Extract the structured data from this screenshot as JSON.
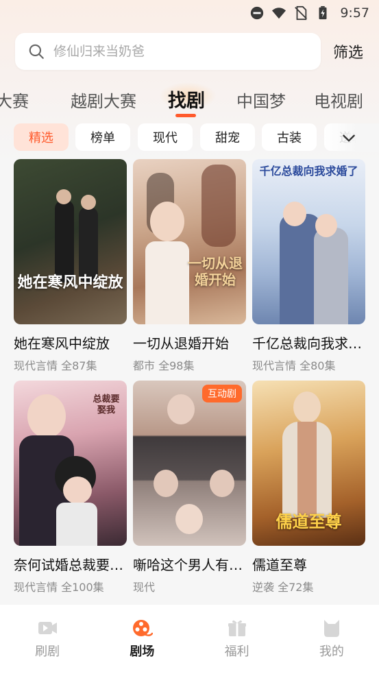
{
  "status_bar": {
    "time": "9:57",
    "icons": [
      "dnd-icon",
      "wifi-icon",
      "no-sim-icon",
      "battery-charging-icon"
    ]
  },
  "search": {
    "placeholder": "修仙归来当奶爸",
    "filter_label": "筛选"
  },
  "category_tabs": [
    {
      "label": "大赛",
      "active": false
    },
    {
      "label": "越剧大赛",
      "active": false
    },
    {
      "label": "找剧",
      "active": true
    },
    {
      "label": "中国梦",
      "active": false
    },
    {
      "label": "电视剧",
      "active": false
    }
  ],
  "genre_chips": [
    {
      "label": "精选",
      "active": true
    },
    {
      "label": "榜单",
      "active": false
    },
    {
      "label": "现代",
      "active": false
    },
    {
      "label": "甜宠",
      "active": false
    },
    {
      "label": "古装",
      "active": false
    },
    {
      "label": "逆袭",
      "active": false
    }
  ],
  "dramas": [
    {
      "title": "她在寒风中绽放",
      "meta": "现代言情 全87集",
      "cover_text": "她在寒风中绽放",
      "badge": ""
    },
    {
      "title": "一切从退婚开始",
      "meta": "都市 全98集",
      "cover_text": "一切从退婚开始",
      "badge": ""
    },
    {
      "title": "千亿总裁向我求婚了",
      "meta": "现代言情 全80集",
      "cover_text": "千亿总裁向我求婚了",
      "badge": ""
    },
    {
      "title": "奈何试婚总裁要娶我",
      "meta": "现代言情 全100集",
      "cover_text": "总裁要娶我",
      "badge": ""
    },
    {
      "title": "噺哈这个男人有点甜",
      "meta": "现代",
      "cover_text": "",
      "badge": "互动剧"
    },
    {
      "title": "儒道至尊",
      "meta": "逆袭 全72集",
      "cover_text": "儒道至尊",
      "badge": ""
    }
  ],
  "bottom_nav": [
    {
      "label": "刷剧",
      "icon": "play-video-icon",
      "active": false
    },
    {
      "label": "剧场",
      "icon": "film-reel-icon",
      "active": true
    },
    {
      "label": "福利",
      "icon": "gift-icon",
      "active": false
    },
    {
      "label": "我的",
      "icon": "profile-cat-icon",
      "active": false
    }
  ],
  "colors": {
    "accent": "#ff5a2c",
    "chip_active_bg": "#ffe3d8",
    "badge": "#ff6a2c"
  }
}
